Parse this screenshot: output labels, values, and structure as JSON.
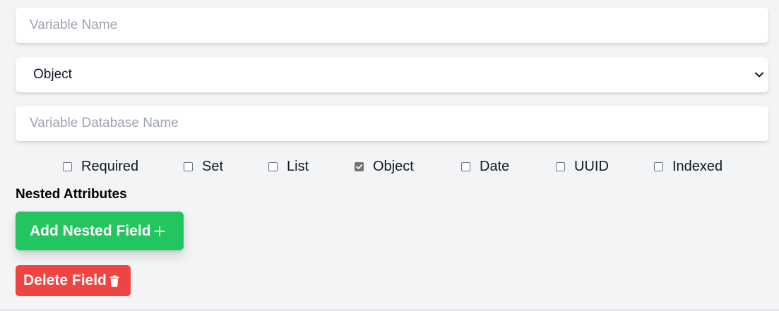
{
  "form": {
    "variable_name": {
      "value": "",
      "placeholder": "Variable Name"
    },
    "type_select": {
      "selected": "Object"
    },
    "database_name": {
      "value": "",
      "placeholder": "Variable Database Name"
    },
    "checkboxes": [
      {
        "label": "Required",
        "checked": false
      },
      {
        "label": "Set",
        "checked": false
      },
      {
        "label": "List",
        "checked": false
      },
      {
        "label": "Object",
        "checked": true
      },
      {
        "label": "Date",
        "checked": false
      },
      {
        "label": "UUID",
        "checked": false
      },
      {
        "label": "Indexed",
        "checked": false
      }
    ],
    "nested_title": "Nested Attributes",
    "add_nested_label": "Add Nested Field",
    "add_nested_icon": "plus-icon",
    "delete_label": "Delete Field",
    "delete_icon": "trash-icon"
  },
  "colors": {
    "background": "#f3f4f6",
    "add_button": "#22c55e",
    "delete_button": "#ef4444",
    "placeholder": "#9ca3af"
  }
}
